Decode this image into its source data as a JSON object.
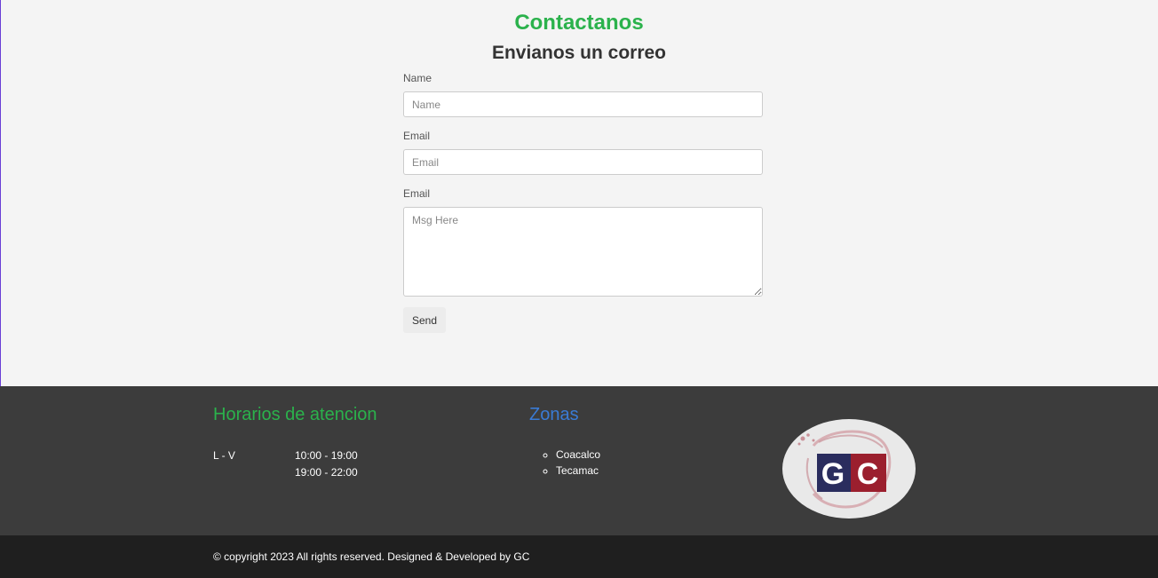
{
  "contact": {
    "title": "Contactanos",
    "subtitle": "Envianos un correo",
    "name_label": "Name",
    "name_placeholder": "Name",
    "email_label": "Email",
    "email_placeholder": "Email",
    "message_label": "Email",
    "message_placeholder": "Msg Here",
    "send_label": "Send"
  },
  "footer": {
    "hours_title": "Horarios de atencion",
    "days": "L - V",
    "times": [
      "10:00 - 19:00",
      "19:00 - 22:00"
    ],
    "zones_title": "Zonas",
    "zones": [
      "Coacalco",
      "Tecamac"
    ],
    "logo_text": "GC",
    "copyright": "© copyright 2023 All rights reserved. Designed & Developed by GC"
  },
  "colors": {
    "title_green": "#2bb24c",
    "zones_blue": "#3a7bd5",
    "footer_bg": "#3c3c3c",
    "bottom_bar_bg": "#1f1f1f",
    "logo_navy": "#2a2d5e",
    "logo_red": "#9b1f2e"
  }
}
